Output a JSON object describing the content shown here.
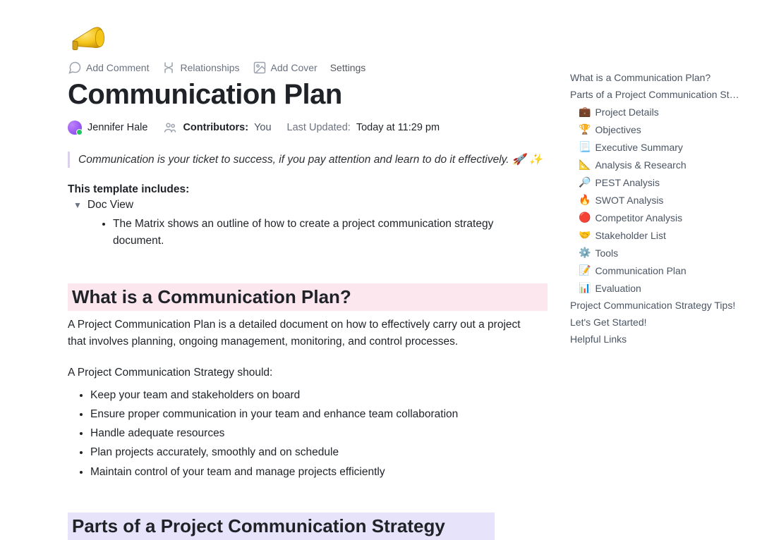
{
  "icon": "📣",
  "toolbar": {
    "comment": "Add Comment",
    "relationships": "Relationships",
    "cover": "Add Cover",
    "settings": "Settings"
  },
  "title": "Communication Plan",
  "meta": {
    "owner": "Jennifer Hale",
    "contributors_label": "Contributors:",
    "contributors_value": "You",
    "lastupdated_label": "Last Updated:",
    "lastupdated_value": "Today at 11:29 pm"
  },
  "quote": "Communication is your ticket to success, if you pay attention and learn to do it effectively. 🚀 ✨",
  "includes_label": "This template includes:",
  "docview_label": "Doc View",
  "matrix_bullet": "The Matrix shows an outline of how to create a project communication strategy document.",
  "section1": {
    "heading": "What is a Communication Plan?",
    "para": "A Project Communication Plan is a detailed document on how to effectively carry out a project that involves planning, ongoing management, monitoring, and control processes.",
    "should_label": "A Project Communication Strategy should:",
    "bullets": [
      "Keep your team and stakeholders on board",
      "Ensure proper communication in your team and enhance team collaboration",
      "Handle adequate resources",
      "Plan projects accurately, smoothly and on schedule",
      "Maintain control of your team and manage projects efficiently"
    ]
  },
  "section2_heading": "Parts of a Project Communication Strategy",
  "outline": {
    "top": [
      "What is a Communication Plan?",
      "Parts of a Project Communication St…"
    ],
    "subs": [
      {
        "emoji": "💼",
        "label": "Project Details"
      },
      {
        "emoji": "🏆",
        "label": "Objectives"
      },
      {
        "emoji": "📃",
        "label": "Executive Summary"
      },
      {
        "emoji": "📐",
        "label": "Analysis & Research"
      },
      {
        "emoji": "🔎",
        "label": "PEST Analysis"
      },
      {
        "emoji": "🔥",
        "label": "SWOT Analysis"
      },
      {
        "emoji": "🔴",
        "label": "Competitor Analysis"
      },
      {
        "emoji": "🤝",
        "label": "Stakeholder List"
      },
      {
        "emoji": "⚙️",
        "label": "Tools"
      },
      {
        "emoji": "📝",
        "label": "Communication Plan"
      },
      {
        "emoji": "📊",
        "label": "Evaluation"
      }
    ],
    "bottom": [
      "Project Communication Strategy Tips!",
      "Let's Get Started!",
      "Helpful Links"
    ]
  }
}
